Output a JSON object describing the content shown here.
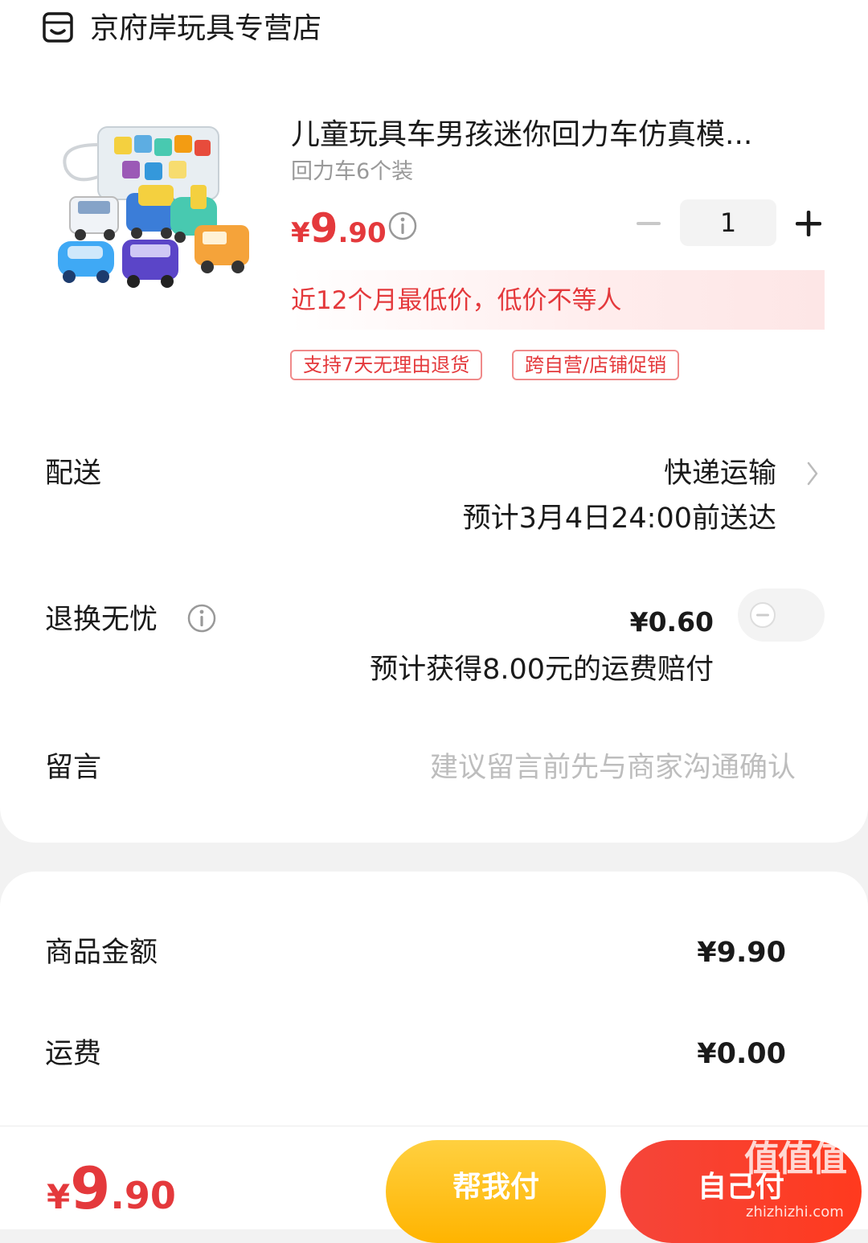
{
  "store": {
    "icon": "store-icon",
    "name": "京府岸玩具专营店"
  },
  "product": {
    "image": "toy-cars-product-image",
    "title": "儿童玩具车男孩迷你回力车仿真模...",
    "spec": "回力车6个装",
    "price_yen": "¥",
    "price_int": "9",
    "price_dec": ".90",
    "quantity": "1",
    "lowest_price_note": "近12个月最低价，低价不等人",
    "tags": [
      "支持7天无理由退货",
      "跨自营/店铺促销"
    ]
  },
  "delivery": {
    "label": "配送",
    "method": "快递运输",
    "eta": "预计3月4日24:00前送达"
  },
  "return_insurance": {
    "label": "退换无忧",
    "price": "¥0.60",
    "note": "预计获得8.00元的运费赔付",
    "enabled": false
  },
  "message": {
    "label": "留言",
    "placeholder": "建议留言前先与商家沟通确认",
    "value": ""
  },
  "summary": {
    "goods_label": "商品金额",
    "goods_value": "¥9.90",
    "shipping_label": "运费",
    "shipping_value": "¥0.00"
  },
  "bottom": {
    "total_yen": "¥",
    "total_int": "9",
    "total_dec": ".90",
    "help_pay_label": "帮我付",
    "self_pay_label": "自己付"
  },
  "watermark": {
    "text": "值值值",
    "sub": "zhizhizhi.com"
  },
  "colors": {
    "accent_red": "#e4393c",
    "button_yellow": "#ffb400",
    "button_red": "#f5453a"
  }
}
